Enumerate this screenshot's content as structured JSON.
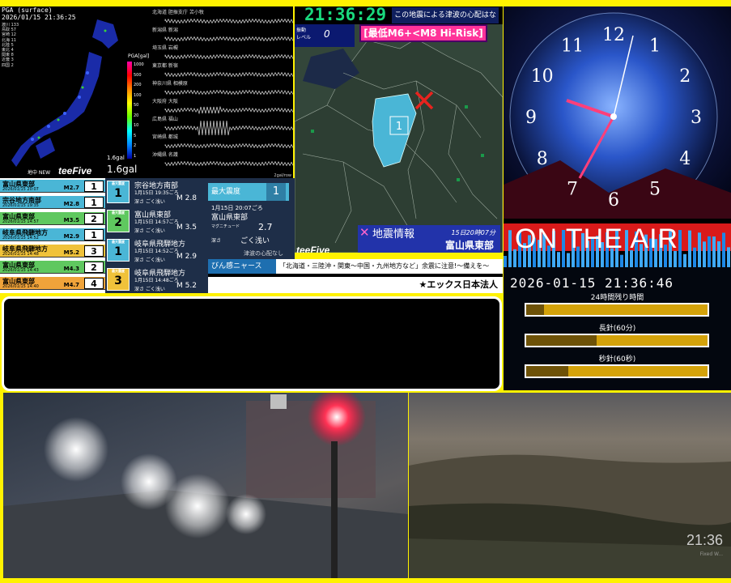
{
  "seismic": {
    "header_line1": "PGA (surface)",
    "header_line2": "2026/01/15 21:36:25",
    "legend_title": "PGA[gal]",
    "legend_ticks": [
      "1000",
      "500",
      "200",
      "100",
      "50",
      "20",
      "10",
      "5",
      "2",
      "1"
    ],
    "gal_small": "1.6gal",
    "gal_big": "1.6gal",
    "logo": "teeFive",
    "underground_label": "地中 NEW",
    "stations_list": [
      "渡川 133",
      "鳥取 57",
      "宮崎 12",
      "北海 11",
      "北陸 5",
      "東北 4",
      "関東 8",
      "近畿 3",
      "四国 2"
    ],
    "wave_stations": [
      "北海道 胆振支庁 苫小牧",
      "新潟県 新潟",
      "埼玉県 岩槻",
      "東京都 新宿",
      "神奈川県 相模原",
      "大阪府 大阪",
      "広島県 福山",
      "宮崎県 都城",
      "沖縄県 名護"
    ],
    "wave_footer": "2gal/row"
  },
  "clock": {
    "digital_time": "21:36:29",
    "tsunami_notice": "この地震による津波の心配はなし"
  },
  "map": {
    "level_label": "振動\nレベル",
    "level_value": "0",
    "risk_label": "[最低M6+<M8 Hi-Risk]",
    "intensity_marker": "1",
    "quake_title": "地震情報",
    "quake_time": "15日20時07分",
    "quake_region": "富山県東部",
    "logo": "teeFive"
  },
  "quake_list": {
    "header": "最大震度",
    "rows": [
      {
        "name": "富山県東部",
        "date": "2026/01/15 20:07",
        "mag": "M2.7",
        "scale": "1",
        "color": "#4ab6d6"
      },
      {
        "name": "宗谷地方南部",
        "date": "2026/01/15 19:35",
        "mag": "M2.8",
        "scale": "1",
        "color": "#4ab6d6"
      },
      {
        "name": "富山県東部",
        "date": "2026/01/15 14:57",
        "mag": "M3.5",
        "scale": "2",
        "color": "#5fc85f"
      },
      {
        "name": "岐阜県飛騨地方",
        "date": "2026/01/15 14:52",
        "mag": "M2.9",
        "scale": "1",
        "color": "#4ab6d6"
      },
      {
        "name": "岐阜県飛騨地方",
        "date": "2026/01/15 14:48",
        "mag": "M5.2",
        "scale": "3",
        "color": "#f0c23a"
      },
      {
        "name": "富山県東部",
        "date": "2026/01/15 14:43",
        "mag": "M4.3",
        "scale": "2",
        "color": "#5fc85f"
      },
      {
        "name": "富山県東部",
        "date": "2026/01/15 14:40",
        "mag": "M4.7",
        "scale": "4",
        "color": "#f0a33a"
      }
    ]
  },
  "recent": {
    "scale_caption": "最大震度",
    "items": [
      {
        "name": "宗谷地方南部",
        "time": "1月15日 19:35ごろ",
        "depth": "深さ ごく浅い",
        "mag": "M 2.8",
        "scale": "1",
        "color": "#4ab6d6"
      },
      {
        "name": "富山県東部",
        "time": "1月15日 14:57ごろ",
        "depth": "深さ ごく浅い",
        "mag": "M 3.5",
        "scale": "2",
        "color": "#5fc85f"
      },
      {
        "name": "岐阜県飛騨地方",
        "time": "1月15日 14:52ごろ",
        "depth": "深さ ごく浅い",
        "mag": "M 2.9",
        "scale": "1",
        "color": "#4ab6d6"
      },
      {
        "name": "岐阜県飛騨地方",
        "time": "1月15日 14:48ごろ",
        "depth": "深さ ごく浅い",
        "mag": "M 5.2",
        "scale": "3",
        "color": "#f0c23a"
      }
    ]
  },
  "detail": {
    "max_label": "最大震度",
    "max_value": "1",
    "time": "1月15日 20:07ごろ",
    "region": "富山県東部",
    "magnitude_label": "マグニチュード",
    "magnitude": "2.7",
    "depth_label": "深さ",
    "depth": "ごく浅い",
    "tsunami": "津波の心配なし"
  },
  "ticker": {
    "name": "びん感ニャース",
    "text": "「北海道・三陸沖・関東〜中国・九州地方など」余震に注意!〜備えを〜",
    "sponsor": "★エックス日本法人"
  },
  "art": {
    "on_air": "ON THE AIR",
    "clock_numbers": [
      "12",
      "1",
      "2",
      "3",
      "4",
      "5",
      "6",
      "7",
      "8",
      "9",
      "10",
      "11"
    ]
  },
  "timer": {
    "datetime": "2026-01-15 21:36:46",
    "rows": [
      {
        "label": "24時間残り時間",
        "progress": 0.1
      },
      {
        "label": "長針(60分)",
        "progress": 0.39
      },
      {
        "label": "秒針(60秒)",
        "progress": 0.23
      }
    ]
  },
  "cameras": {
    "cam2_time": "21:36",
    "cam2_watermark": "Fixed W..."
  },
  "colors": {
    "frame": "#fff200",
    "digital_clock": "#19d97d",
    "risk_badge": "#ff3399",
    "on_air": "#ff1e1e"
  }
}
